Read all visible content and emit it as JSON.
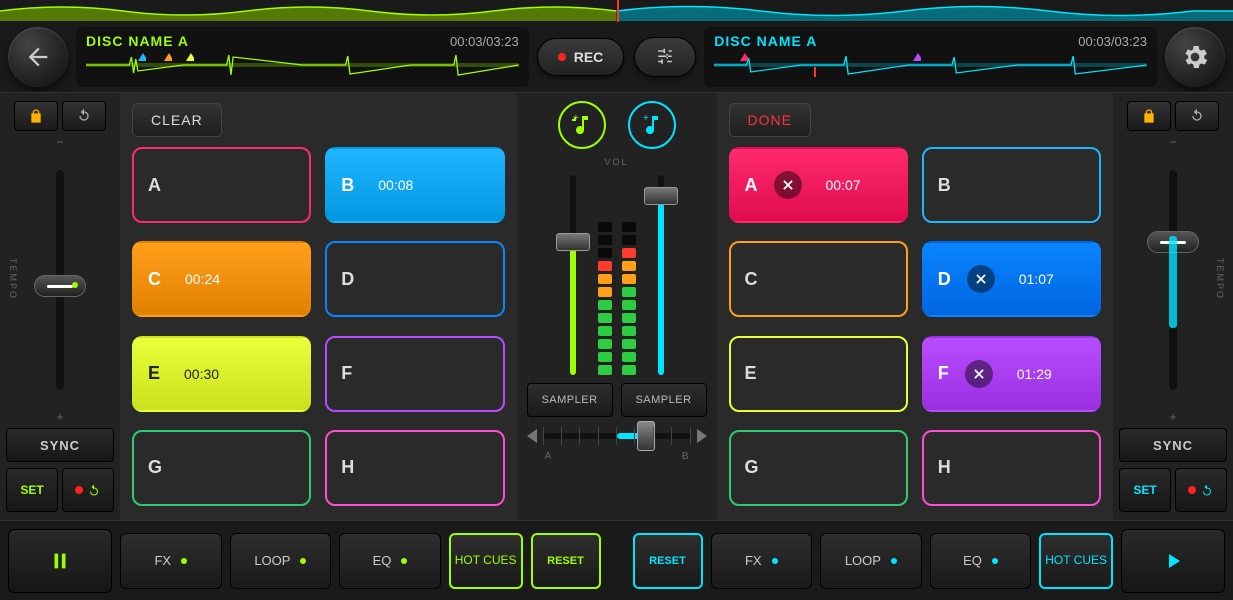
{
  "deckA": {
    "title": "DISC NAME A",
    "elapsed": "00:03",
    "total": "03:23",
    "clear_btn": "CLEAR",
    "sync": "SYNC",
    "set": "SET",
    "cues": [
      {
        "label": "A",
        "time": "",
        "color": "#ff2a6d",
        "filled": false
      },
      {
        "label": "B",
        "time": "00:08",
        "color": "#1fb6ff",
        "filled": true
      },
      {
        "label": "C",
        "time": "00:24",
        "color": "#ff9f1a",
        "filled": true
      },
      {
        "label": "D",
        "time": "",
        "color": "#0a84ff",
        "filled": false
      },
      {
        "label": "E",
        "time": "00:30",
        "color": "#e9ff3a",
        "filled": true
      },
      {
        "label": "F",
        "time": "",
        "color": "#b84dff",
        "filled": false
      },
      {
        "label": "G",
        "time": "",
        "color": "#2ecc71",
        "filled": false
      },
      {
        "label": "H",
        "time": "",
        "color": "#ff4dd2",
        "filled": false
      }
    ],
    "fx": {
      "fx": "FX",
      "loop": "LOOP",
      "eq": "EQ",
      "hot": "HOT CUES",
      "reset": "RESET"
    }
  },
  "deckB": {
    "title": "DISC NAME A",
    "elapsed": "00:03",
    "total": "03:23",
    "done_btn": "DONE",
    "sync": "SYNC",
    "set": "SET",
    "cues": [
      {
        "label": "A",
        "time": "00:07",
        "color": "#ff2a6d",
        "filled": true,
        "x": true
      },
      {
        "label": "B",
        "time": "",
        "color": "#1fb6ff",
        "filled": false
      },
      {
        "label": "C",
        "time": "",
        "color": "#ff9f1a",
        "filled": false
      },
      {
        "label": "D",
        "time": "01:07",
        "color": "#0a84ff",
        "filled": true,
        "x": true
      },
      {
        "label": "E",
        "time": "",
        "color": "#e9ff3a",
        "filled": false
      },
      {
        "label": "F",
        "time": "01:29",
        "color": "#b84dff",
        "filled": true,
        "x": true
      },
      {
        "label": "G",
        "time": "",
        "color": "#2ecc71",
        "filled": false
      },
      {
        "label": "H",
        "time": "",
        "color": "#ff4dd2",
        "filled": false
      }
    ],
    "fx": {
      "fx": "FX",
      "loop": "LOOP",
      "eq": "EQ",
      "hot": "HOT CUES",
      "reset": "RESET"
    }
  },
  "center": {
    "rec": "REC",
    "vol": "VOL",
    "sampler": "SAMPLER",
    "xf_a": "A",
    "xf_b": "B"
  },
  "colors": {
    "accentA": "#9fff00",
    "accentB": "#00e5ff",
    "rec": "#ff2222",
    "lock": "#ffb300"
  }
}
